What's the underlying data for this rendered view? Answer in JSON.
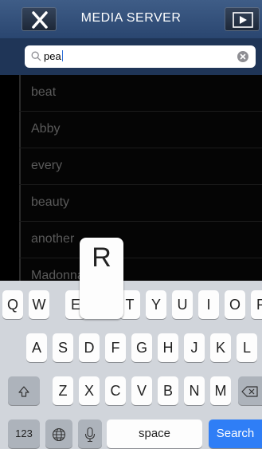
{
  "header": {
    "title": "MEDIA SERVER",
    "close_icon": "close-icon",
    "play_icon": "play-icon"
  },
  "search": {
    "value": "pea",
    "icon": "search-icon",
    "clear_icon": "clear-icon"
  },
  "results": [
    "beat",
    "Abby",
    "every",
    "beauty",
    "another",
    "Madonna"
  ],
  "keyboard": {
    "row1": [
      "Q",
      "W",
      "E",
      "R",
      "T",
      "Y",
      "U",
      "I",
      "O",
      "P"
    ],
    "row2": [
      "A",
      "S",
      "D",
      "F",
      "G",
      "H",
      "J",
      "K",
      "L"
    ],
    "row3": [
      "Z",
      "X",
      "C",
      "V",
      "B",
      "N",
      "M"
    ],
    "shift_icon": "shift-icon",
    "backspace_icon": "backspace-icon",
    "numbers_label": "123",
    "globe_icon": "globe-icon",
    "mic_icon": "mic-icon",
    "space_label": "space",
    "search_label": "Search",
    "pressed_key": "R"
  },
  "colors": {
    "header": "#3f5d87",
    "search_key": "#2f7ef6",
    "keyboard_bg": "#d1d5db"
  }
}
